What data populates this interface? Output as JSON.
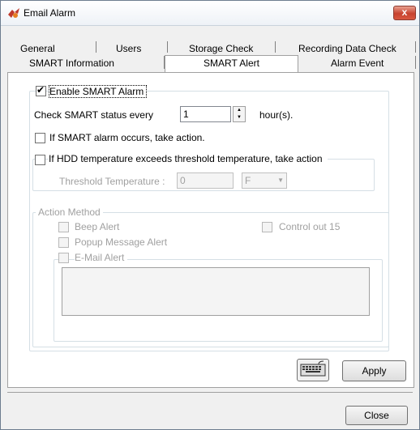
{
  "window": {
    "title": "Email Alarm",
    "close_glyph": "x"
  },
  "tabs_row1": [
    "General",
    "Users",
    "Storage Check",
    "Recording Data Check"
  ],
  "tabs_row2": [
    "SMART Information",
    "SMART Alert",
    "Alarm Event"
  ],
  "active_tab": "SMART Alert",
  "smart": {
    "enable_label": "Enable SMART Alarm",
    "enable_checked": true,
    "check_label": "Check SMART status every",
    "check_value": "1",
    "check_unit": "hour(s).",
    "alarm_action_label": "If SMART alarm occurs, take action.",
    "temp_label": "If HDD temperature exceeds threshold temperature, take action",
    "threshold_label": "Threshold Temperature :",
    "threshold_value": "0",
    "unit_value": "F"
  },
  "action_method": {
    "legend": "Action Method",
    "beep": "Beep Alert",
    "popup": "Popup Message Alert",
    "email": "E-Mail Alert",
    "control": "Control out 15"
  },
  "buttons": {
    "apply": "Apply",
    "close": "Close"
  },
  "icons": {
    "app": "app-logo-icon",
    "keyboard": "keyboard-icon"
  }
}
